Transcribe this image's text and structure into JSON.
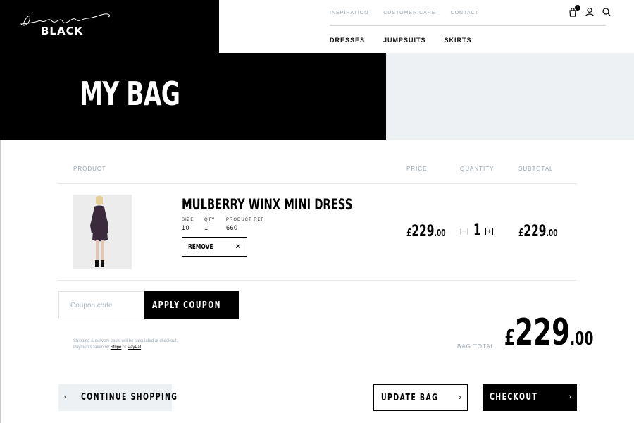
{
  "brand": {
    "script": "Louise",
    "name": "BLACK"
  },
  "top_links": [
    "INSPIRATION",
    "CUSTOMER CARE",
    "CONTACT"
  ],
  "cart_count": "1",
  "nav": [
    "DRESSES",
    "JUMPSUITS",
    "SKIRTS"
  ],
  "hero": {
    "title": "MY BAG"
  },
  "table_headers": {
    "product": "PRODUCT",
    "price": "PRICE",
    "quantity": "QUANTITY",
    "subtotal": "SUBTOTAL"
  },
  "item": {
    "name": "MULBERRY WINX MINI DRESS",
    "size_label": "SIZE",
    "size": "10",
    "qty_label": "QTY",
    "qty": "1",
    "ref_label": "PRODUCT REF",
    "ref": "660",
    "remove_label": "REMOVE",
    "price_currency": "£",
    "price_whole": "229",
    "price_cents": ".00",
    "quantity": "1",
    "subtotal_currency": "£",
    "subtotal_whole": "229",
    "subtotal_cents": ".00"
  },
  "coupon": {
    "placeholder": "Coupon code",
    "button": "APPLY COUPON"
  },
  "shipping": {
    "line1": "Shipping & delivery costs will be calculated at checkout.",
    "line2_prefix": "Payments taken by",
    "stripe": "Stripe",
    "or": "or",
    "paypal": "PayPal"
  },
  "total": {
    "label": "BAG TOTAL",
    "currency": "£",
    "whole": "229",
    "cents": ".00"
  },
  "buttons": {
    "continue": "CONTINUE SHOPPING",
    "update": "UPDATE BAG",
    "checkout": "CHECKOUT"
  },
  "colors": {
    "black": "#000000",
    "muted": "#9aa7b2",
    "panel": "#eef1f4"
  }
}
